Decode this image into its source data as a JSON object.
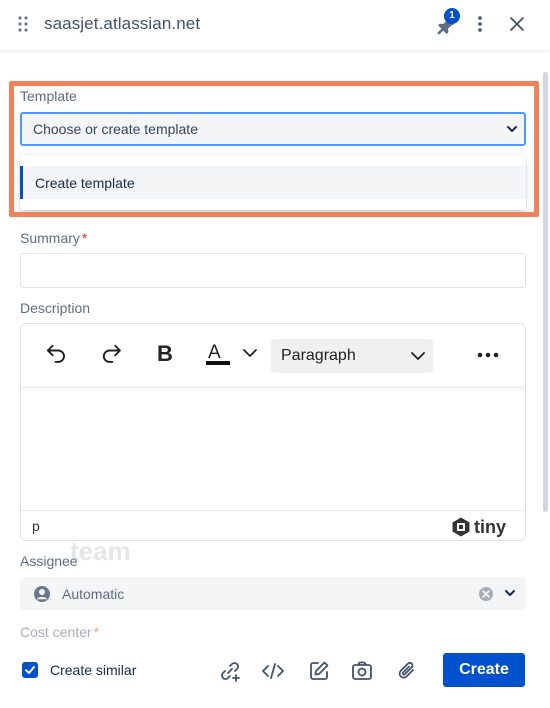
{
  "header": {
    "site": "saasjet.atlassian.net",
    "pin_badge": "1"
  },
  "template": {
    "label": "Template",
    "placeholder": "Choose or create template",
    "menu_item": "Create template"
  },
  "summary": {
    "label": "Summary",
    "required_mark": "*"
  },
  "description": {
    "label": "Description",
    "format": "Paragraph",
    "path": "p",
    "brand": "tiny"
  },
  "assignee": {
    "label": "Assignee",
    "value": "Automatic"
  },
  "cost_center": {
    "label": "Cost center",
    "required_mark": "*"
  },
  "footer": {
    "create_similar": "Create similar",
    "create_similar_checked": true,
    "create_button": "Create"
  },
  "background_text": {
    "word": "team"
  },
  "colors": {
    "accent": "#0052cc",
    "highlight": "#f0825a",
    "required": "#de350b"
  }
}
